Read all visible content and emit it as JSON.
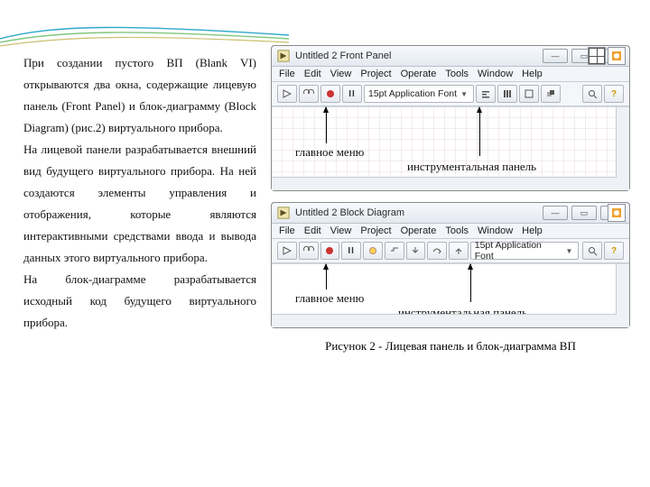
{
  "paragraphs": {
    "p1": "При создании пустого ВП (Blank VI) открываются два окна, содержащие лицевую панель (Front Panel) и блок-диаграмму (Block Diagram) (рис.2) виртуального прибора.",
    "p2": "На лицевой панели разрабатывается внешний вид будущего виртуального прибора. На ней создаются элементы управления и отображения, которые являются интерактивными средствами ввода и вывода данных этого виртуального прибора.",
    "p3": "На блок-диаграмме разрабатывается исходный код будущего виртуального прибора."
  },
  "caption": "Рисунок  2 - Лицевая панель и блок-диаграмма ВП",
  "fp": {
    "title": "Untitled 2 Front Panel",
    "menu": [
      "File",
      "Edit",
      "View",
      "Project",
      "Operate",
      "Tools",
      "Window",
      "Help"
    ],
    "font": "15pt Application Font",
    "ann_menu": "главное меню",
    "ann_toolbar": "инструментальная панель"
  },
  "bd": {
    "title": "Untitled 2 Block Diagram",
    "menu": [
      "File",
      "Edit",
      "View",
      "Project",
      "Operate",
      "Tools",
      "Window",
      "Help"
    ],
    "font": "15pt Application Font",
    "ann_menu": "главное меню",
    "ann_toolbar": "инструментальная панель"
  },
  "winctl": {
    "min": "—",
    "max": "▭",
    "close": "✕"
  }
}
